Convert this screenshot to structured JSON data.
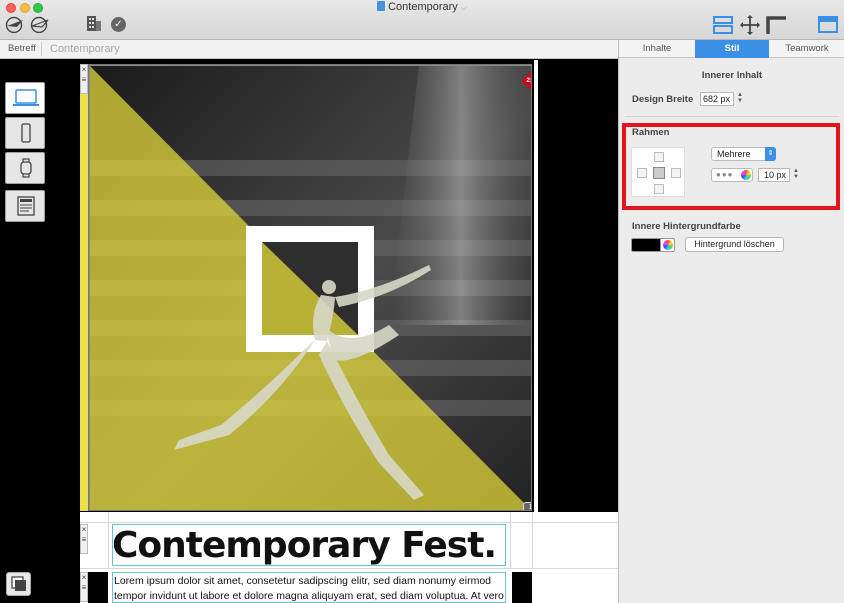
{
  "window": {
    "title": "Contemporary"
  },
  "breadcrumb": {
    "label": "Betreff",
    "value": "Contemporary"
  },
  "toolbar": {
    "check_icon": "✓"
  },
  "canvas": {
    "heading": "Contemporary Fest.",
    "body_text": "Lorem ipsum dolor sit amet, consetetur sadipscing elitr, sed diam nonumy eirmod tempor invidunt ut labore et dolore magna aliquyam erat, sed diam voluptua. At vero",
    "image_badge": "2x",
    "row_badge": "1",
    "highlight_color": "#e6dd3a"
  },
  "inspector": {
    "tabs": [
      "Inhalte",
      "Stil",
      "Teamwork"
    ],
    "active_tab": "Stil",
    "inner_content": {
      "title": "Innerer Inhalt",
      "design_width_label": "Design Breite",
      "design_width_value": "682 px"
    },
    "border": {
      "title": "Rahmen",
      "mode": "Mehrere",
      "style_dots": "●●●",
      "width_value": "10 px",
      "highlight_color": "#e3151b"
    },
    "background": {
      "label": "Innere Hintergrundfarbe",
      "color": "#000000",
      "clear_button": "Hintergrund löschen"
    }
  }
}
